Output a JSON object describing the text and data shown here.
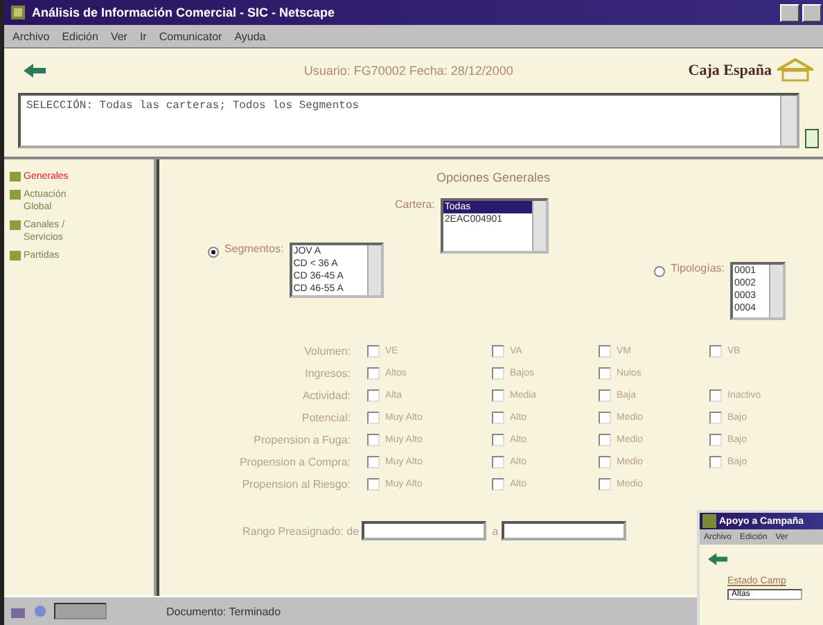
{
  "window": {
    "title": "Análisis de Información Comercial - SIC - Netscape"
  },
  "menu": [
    "Archivo",
    "Edición",
    "Ver",
    "Ir",
    "Comunicator",
    "Ayuda"
  ],
  "header": {
    "user_info": "Usuario: FG70002  Fecha: 28/12/2000",
    "brand": "Caja España"
  },
  "selection_text": "SELECCIÓN: Todas las carteras; Todos los Segmentos",
  "sidebar": {
    "items": [
      {
        "label": "Generales",
        "selected": true
      },
      {
        "label": "Actuación Global",
        "selected": false
      },
      {
        "label": "Canales / Servicios",
        "selected": false
      },
      {
        "label": "Partidas",
        "selected": false
      }
    ]
  },
  "main": {
    "heading": "Opciones Generales",
    "cartera": {
      "label": "Cartera:",
      "options": [
        {
          "label": "Todas",
          "selected": true
        },
        {
          "label": "2EAC004901",
          "selected": false
        }
      ]
    },
    "segmentos": {
      "label": "Segmentos:",
      "selected": true,
      "options": [
        {
          "label": "JOV A",
          "selected": false
        },
        {
          "label": "CD < 36 A",
          "selected": false
        },
        {
          "label": "CD 36-45 A",
          "selected": false
        },
        {
          "label": "CD 46-55 A",
          "selected": false
        }
      ]
    },
    "tipologias": {
      "label": "Tipologías:",
      "selected": false,
      "options": [
        {
          "label": "0001",
          "selected": false
        },
        {
          "label": "0002",
          "selected": false
        },
        {
          "label": "0003",
          "selected": false
        },
        {
          "label": "0004",
          "selected": false
        }
      ]
    },
    "criteria": [
      {
        "label": "Volumen:",
        "options": [
          {
            "label": "VE",
            "checked": false
          },
          {
            "label": "VA",
            "checked": false
          },
          {
            "label": "VM",
            "checked": false
          },
          {
            "label": "VB",
            "checked": false
          }
        ]
      },
      {
        "label": "Ingresos:",
        "options": [
          {
            "label": "Altos",
            "checked": false
          },
          {
            "label": "Bajos",
            "checked": false
          },
          {
            "label": "Nulos",
            "checked": false
          }
        ]
      },
      {
        "label": "Actividad:",
        "options": [
          {
            "label": "Alta",
            "checked": false
          },
          {
            "label": "Media",
            "checked": false
          },
          {
            "label": "Baja",
            "checked": false
          },
          {
            "label": "Inactivo",
            "checked": false
          }
        ]
      },
      {
        "label": "Potencial:",
        "options": [
          {
            "label": "Muy Alto",
            "checked": false
          },
          {
            "label": "Alto",
            "checked": false
          },
          {
            "label": "Medio",
            "checked": false
          },
          {
            "label": "Bajo",
            "checked": false
          }
        ]
      },
      {
        "label": "Propension a Fuga:",
        "options": [
          {
            "label": "Muy Alto",
            "checked": false
          },
          {
            "label": "Alto",
            "checked": false
          },
          {
            "label": "Medio",
            "checked": false
          },
          {
            "label": "Bajo",
            "checked": false
          }
        ]
      },
      {
        "label": "Propension a Compra:",
        "options": [
          {
            "label": "Muy Alto",
            "checked": false
          },
          {
            "label": "Alto",
            "checked": false
          },
          {
            "label": "Medio",
            "checked": false
          },
          {
            "label": "Bajo",
            "checked": false
          }
        ]
      },
      {
        "label": "Propension al Riesgo:",
        "options": [
          {
            "label": "Muy Alto",
            "checked": false
          },
          {
            "label": "Alto",
            "checked": false
          },
          {
            "label": "Medio",
            "checked": false
          }
        ]
      }
    ],
    "range": {
      "label": "Rango Preasignado: de",
      "separator": "a"
    }
  },
  "status_bar": {
    "text": "Documento: Terminado"
  },
  "popup": {
    "title": "Apoyo a Campaña",
    "menu": [
      "Archivo",
      "Edición",
      "Ver"
    ],
    "field_label": "Estado Camp",
    "select_value": "Altas"
  }
}
